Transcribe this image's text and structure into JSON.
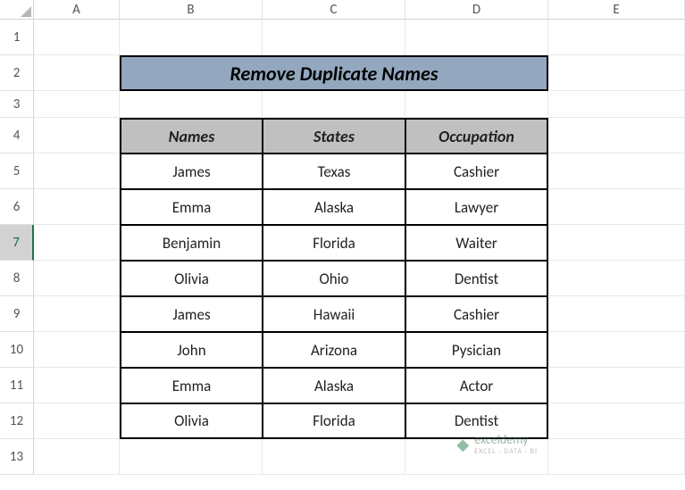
{
  "columns": [
    "A",
    "B",
    "C",
    "D",
    "E"
  ],
  "rows": [
    "1",
    "2",
    "3",
    "4",
    "5",
    "6",
    "7",
    "8",
    "9",
    "10",
    "11",
    "12",
    "13"
  ],
  "selectedRow": 7,
  "title": "Remove Duplicate Names",
  "headers": [
    "Names",
    "States",
    "Occupation"
  ],
  "chart_data": {
    "type": "table",
    "columns": [
      "Names",
      "States",
      "Occupation"
    ],
    "rows": [
      [
        "James",
        "Texas",
        "Cashier"
      ],
      [
        "Emma",
        "Alaska",
        "Lawyer"
      ],
      [
        "Benjamin",
        "Florida",
        "Waiter"
      ],
      [
        "Olivia",
        "Ohio",
        "Dentist"
      ],
      [
        "James",
        "Hawaii",
        "Cashier"
      ],
      [
        "John",
        "Arizona",
        "Pysician"
      ],
      [
        "Emma",
        "Alaska",
        "Actor"
      ],
      [
        "Olivia",
        "Florida",
        "Dentist"
      ]
    ]
  },
  "watermark": {
    "brand": "exceldemy",
    "sub": "EXCEL · DATA · BI"
  }
}
